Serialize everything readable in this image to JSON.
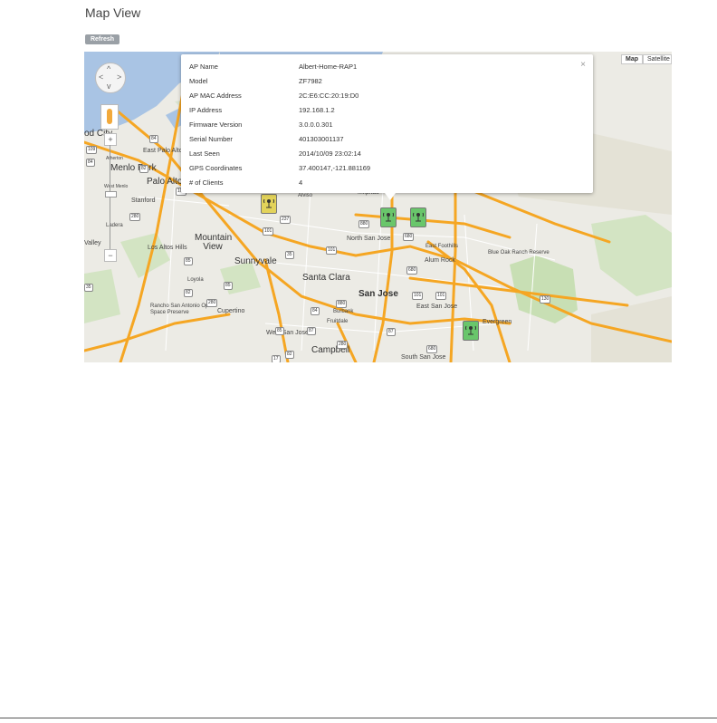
{
  "page": {
    "title": "Map View",
    "refresh_label": "Refresh"
  },
  "map": {
    "type_buttons": [
      "Map",
      "Satellite"
    ],
    "labels": {
      "redwood_city": "od City",
      "east_palo_alto": "East Palo Alto",
      "menlo_park": "Menlo Park",
      "atherton": "Atherton",
      "palo_alto": "Palo Alto",
      "stanford": "Stanford",
      "west_menlo": "West Menlo",
      "ladera": "Ladera",
      "valley": "Valley",
      "los_altos_hills": "Los Altos Hills",
      "mountain_view": "Mountain View",
      "sunnyvale": "Sunnyvale",
      "santa_clara": "Santa Clara",
      "san_jose": "San Jose",
      "north_san_jose": "North San Jose",
      "east_san_jose": "East San Jose",
      "east_foothills": "East Foothills",
      "alum_rock": "Alum Rock",
      "blue_oak": "Blue Oak Ranch Reserve",
      "evergreen": "Evergreen",
      "cupertino": "Cupertino",
      "west_san_jose": "West San Jose",
      "campbell": "Campbell",
      "south_san_jose": "South San Jose",
      "rancho": "Rancho San Antonio Open Space Preserve",
      "loyola": "Loyola",
      "burbank": "Burbank",
      "fruitdale": "Fruitdale",
      "alviso": "Alviso",
      "milpitas": "Milpitas"
    },
    "shields": [
      "84",
      "82",
      "84",
      "109",
      "101",
      "237",
      "280",
      "101",
      "880",
      "101",
      "85",
      "82",
      "85",
      "280",
      "880",
      "101",
      "87",
      "680",
      "101",
      "680",
      "130",
      "680",
      "85",
      "82",
      "87",
      "280",
      "17",
      "35",
      "35",
      "84"
    ]
  },
  "info_window": {
    "rows": [
      {
        "key": "AP Name",
        "value": "Albert-Home-RAP1"
      },
      {
        "key": "Model",
        "value": "ZF7982"
      },
      {
        "key": "AP MAC Address",
        "value": "2C:E6:CC:20:19:D0"
      },
      {
        "key": "IP Address",
        "value": "192.168.1.2"
      },
      {
        "key": "Firmware Version",
        "value": "3.0.0.0.301"
      },
      {
        "key": "Serial Number",
        "value": "401303001137"
      },
      {
        "key": "Last Seen",
        "value": "2014/10/09 23:02:14"
      },
      {
        "key": "GPS Coordinates",
        "value": "37.400147,-121.881169"
      },
      {
        "key": "# of Clients",
        "value": "4"
      }
    ],
    "close_glyph": "×"
  },
  "colors": {
    "highway": "#f5a623",
    "map_bg": "#ecebe5",
    "water": "#a9c4e4",
    "park": "#c8dfb4",
    "marker_green": "#69c66b",
    "marker_yellow": "#e3d35a"
  }
}
